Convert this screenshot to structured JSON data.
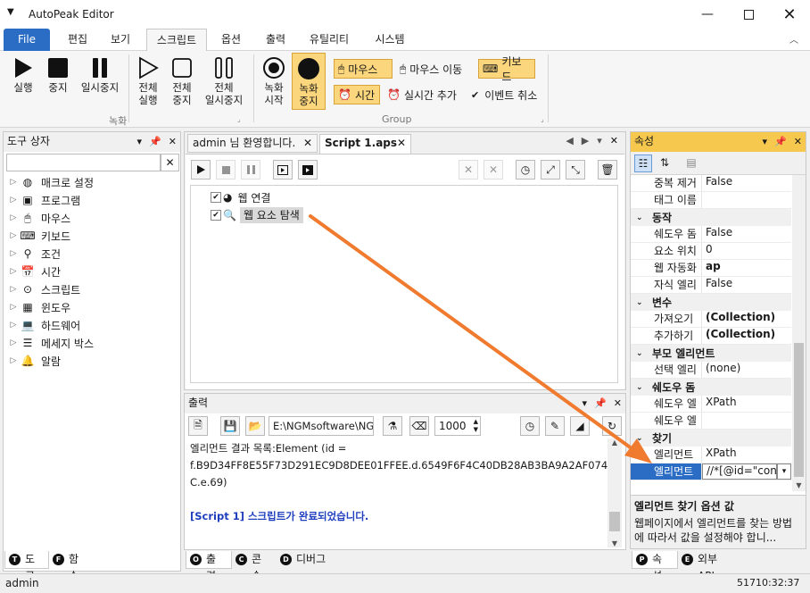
{
  "app": {
    "title": "AutoPeak Editor"
  },
  "tabs": [
    "File",
    "편집",
    "보기",
    "스크립트",
    "옵션",
    "출력",
    "유틸리티",
    "시스템"
  ],
  "ribbon": {
    "record": {
      "run": "실행",
      "stop": "중지",
      "pause": "일시중지",
      "run_all": "전체\n실행",
      "stop_all": "전체\n중지",
      "pause_all": "전체\n일시중지",
      "group": "녹화"
    },
    "rec": {
      "start": "녹화\n시작",
      "stop": "녹화\n중지"
    },
    "group": {
      "mouse": "마우스",
      "mouse_move": "마우스 이동",
      "keyboard": "키보드",
      "time": "시간",
      "realtime_add": "실시간 추가",
      "event_cancel": "이벤트 취소",
      "label": "Group"
    }
  },
  "toolbox": {
    "title": "도구 상자",
    "items": [
      "매크로 설정",
      "프로그램",
      "마우스",
      "키보드",
      "조건",
      "시간",
      "스크립트",
      "윈도우",
      "하드웨어",
      "메세지 박스",
      "알람"
    ],
    "tab_tools": "도구",
    "tab_funcs": "함수"
  },
  "doc_tabs": {
    "welcome": "admin 님 환영합니다.",
    "script": "Script 1.aps"
  },
  "script_items": [
    "웹 연결",
    "웹 요소 탐색"
  ],
  "output": {
    "title": "출력",
    "path": "E:\\NGMsoftware\\NG",
    "count": "1000",
    "lines": [
      "엘리먼트 결과 목록:Element (id =",
      "f.B9D34FF8E55F73D291EC9D8DEE01FFEE.d.6549F6F4C40DB28AB3BA9A2AF074245",
      "C.e.69)",
      "",
      "[Script 1] 스크립트가 완료되었습니다."
    ],
    "tab_output": "출력",
    "tab_console": "콘솔",
    "tab_debug": "디버그"
  },
  "props": {
    "title": "속성",
    "rows": [
      {
        "type": "row",
        "k": "중복 제거",
        "v": "False"
      },
      {
        "type": "row",
        "k": "태그 이름",
        "v": ""
      },
      {
        "type": "cat",
        "k": "동작"
      },
      {
        "type": "row",
        "k": "쉐도우 돔",
        "v": "False"
      },
      {
        "type": "row",
        "k": "요소 위치",
        "v": "0"
      },
      {
        "type": "row",
        "k": "웹 자동화",
        "v": "ap",
        "bold": true
      },
      {
        "type": "row",
        "k": "자식 엘리",
        "v": "False"
      },
      {
        "type": "cat",
        "k": "변수"
      },
      {
        "type": "row",
        "k": "가져오기",
        "v": "(Collection)",
        "bold": true
      },
      {
        "type": "row",
        "k": "추가하기",
        "v": "(Collection)",
        "bold": true
      },
      {
        "type": "cat",
        "k": "부모 엘리먼트"
      },
      {
        "type": "row",
        "k": "선택 엘리",
        "v": "(none)"
      },
      {
        "type": "cat",
        "k": "쉐도우 돔"
      },
      {
        "type": "row",
        "k": "쉐도우 엘",
        "v": "XPath"
      },
      {
        "type": "row",
        "k": "쉐도우 엘",
        "v": ""
      },
      {
        "type": "cat",
        "k": "찾기"
      },
      {
        "type": "row",
        "k": "엘리먼트",
        "v": "XPath"
      },
      {
        "type": "row",
        "k": "엘리먼트",
        "v": "//*[@id=\"con",
        "selected": true
      }
    ],
    "desc_title": "엘리먼트 찾기 옵션 값",
    "desc_text": "웹페이지에서 엘리먼트를 찾는 방법에 따라서 값을 설정해야 합니...",
    "tab_props": "속성",
    "tab_api": "외부 API"
  },
  "status": {
    "user": "admin",
    "time": "51710:32:37"
  },
  "colors": {
    "accent": "#2b6cc4",
    "highlight": "#fbd67c",
    "arrow": "#f07a2e",
    "link": "#1f3fbf"
  }
}
